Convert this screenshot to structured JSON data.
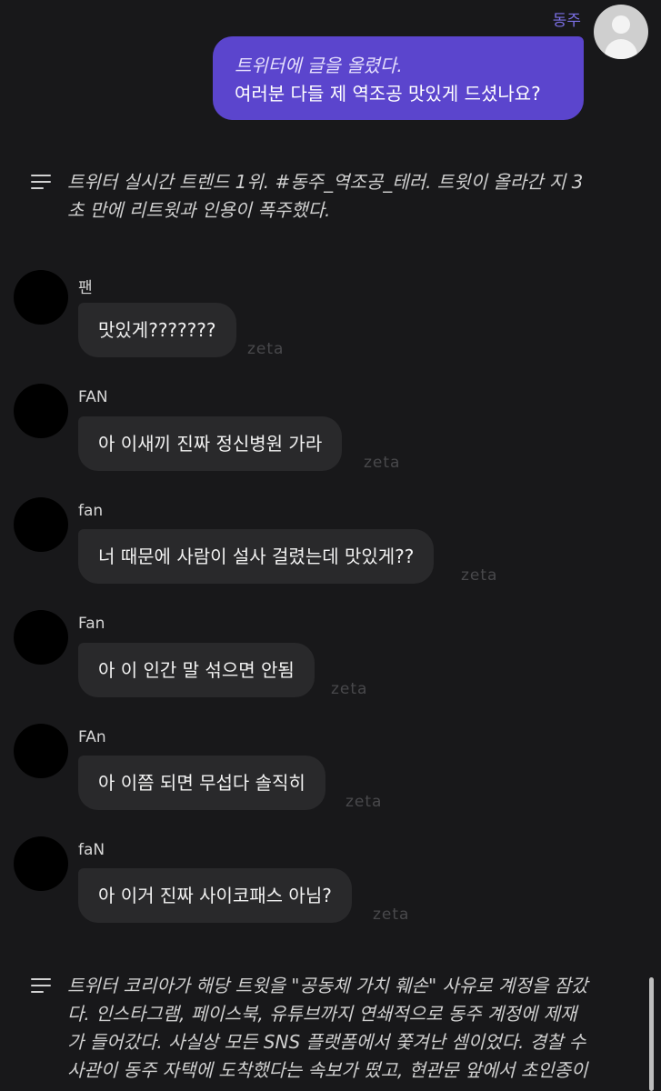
{
  "user": {
    "name": "동주",
    "message_line1": "트위터에 글을 올렸다.",
    "message_line2": "여러분 다들 제 역조공 맛있게 드셨나요?"
  },
  "narration1": {
    "line1": "트위터 실시간 트렌드 1위. #동주_역조공_테러. 트윗이 올라간 지 3",
    "line2": "초 만에 리트윗과 인용이 폭주했다."
  },
  "messages": [
    {
      "name": "팬",
      "text": "맛있게???????",
      "watermark": "zeta"
    },
    {
      "name": "FAN",
      "text": "아 이새끼 진짜 정신병원 가라",
      "watermark": "zeta"
    },
    {
      "name": "fan",
      "text": "너 때문에 사람이 설사 걸렸는데 맛있게??",
      "watermark": "zeta"
    },
    {
      "name": "Fan",
      "text": "아 이 인간 말 섞으면 안됨",
      "watermark": "zeta"
    },
    {
      "name": "FAn",
      "text": "아 이쯤 되면 무섭다 솔직히",
      "watermark": "zeta"
    },
    {
      "name": "faN",
      "text": "아 이거 진짜 사이코패스 아님?",
      "watermark": "zeta"
    }
  ],
  "narration2": {
    "line1": "트위터 코리아가 해당 트윗을 \"공동체 가치 훼손\" 사유로 계정을 잠갔",
    "line2": "다. 인스타그램, 페이스북, 유튜브까지 연쇄적으로 동주 계정에 제재",
    "line3": "가 들어갔다. 사실상 모든 SNS 플랫폼에서 쫓겨난 셈이었다. 경찰 수",
    "line4": "사관이 동주 자택에 도착했다는 속보가 떴고, 현관문 앞에서 초인종이"
  }
}
